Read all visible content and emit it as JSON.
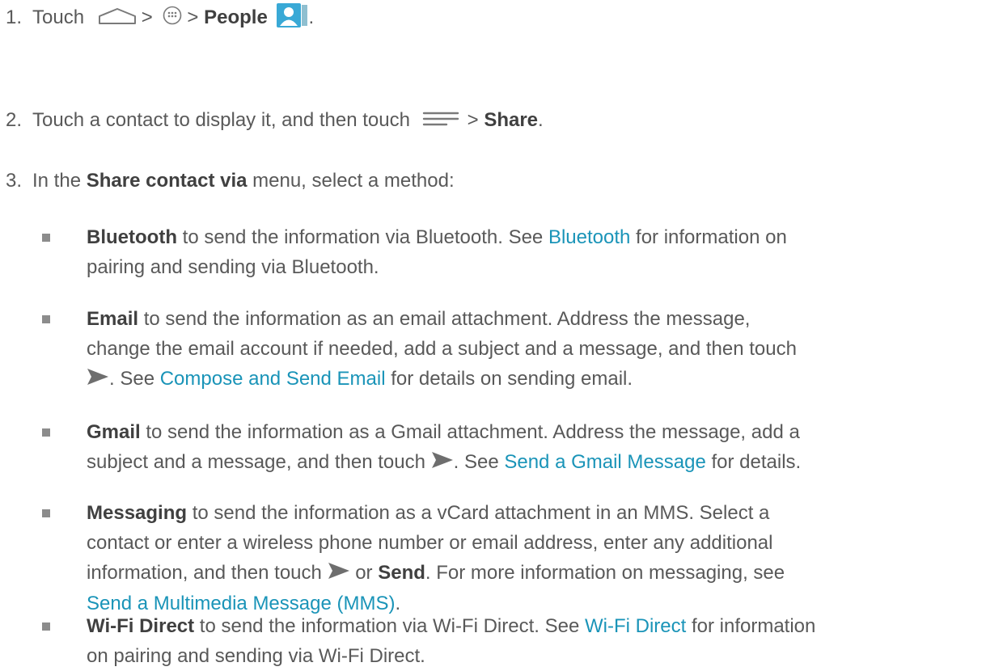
{
  "steps": [
    {
      "num": "1.",
      "text_touch": "Touch",
      "sep1": ">",
      "sep2": ">",
      "people": "People",
      "period": ".",
      "icons": [
        "home-icon",
        "apps-icon",
        "people-app-icon"
      ]
    },
    {
      "num": "2.",
      "text": "Touch a contact to display it, and then touch",
      "sep": ">",
      "share": "Share",
      "period": ".",
      "icons": [
        "menu-icon"
      ]
    },
    {
      "num": "3.",
      "pre": "In the",
      "bold": "Share contact via",
      "post": "menu, select a method:"
    }
  ],
  "methods": [
    {
      "name": "Bluetooth",
      "line1": " to send the information via Bluetooth. See ",
      "link": "Bluetooth",
      "line1b": " for information on",
      "line2": "pairing and sending via Bluetooth."
    },
    {
      "name": "Email",
      "line1": " to send the information as an email attachment. Address the message,",
      "line2": "change the email account if needed, add a subject and a message, and then touch",
      "line3a": ". See ",
      "link": "Compose and Send Email",
      "line3b": " for details on sending email."
    },
    {
      "name": "Gmail",
      "line1": " to send the information as a Gmail attachment. Address the message, add a",
      "line2a": "subject and a message, and then touch ",
      "line2b": ". See ",
      "link": "Send a Gmail Message",
      "line2c": " for details."
    },
    {
      "name": "Messaging",
      "line1": " to send the information as a vCard attachment in an MMS. Select a",
      "line2": "contact or enter a wireless phone number or email address, enter any additional",
      "line3a": "information, and then touch ",
      "or": " or ",
      "send": "Send",
      "line3b": ". For more information on messaging, see",
      "link": "Send a Multimedia Message (MMS)",
      "line4b": "."
    },
    {
      "name": "Wi-Fi Direct",
      "line1": " to send the information via Wi-Fi Direct. See ",
      "link": "Wi-Fi Direct",
      "line1b": " for information",
      "line2": "on pairing and sending via Wi-Fi Direct."
    }
  ],
  "colors": {
    "link": "#1a94b8",
    "text": "#595959",
    "bullet": "#8c8c8c"
  }
}
